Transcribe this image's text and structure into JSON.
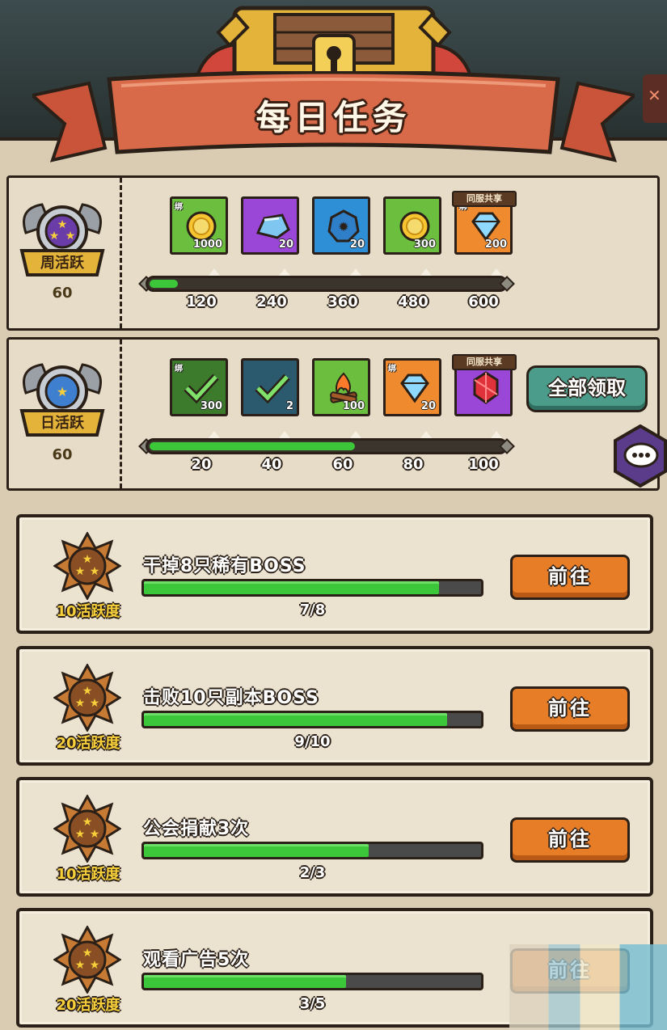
{
  "header": {
    "title": "每日任务"
  },
  "weekly": {
    "label": "周活跃",
    "value": "60",
    "progress": 0.08,
    "rewards": [
      {
        "icon": "gold-coin-icon",
        "qty": "1000",
        "bound": "绑",
        "bg": "#6cbf3e"
      },
      {
        "icon": "blue-stone-icon",
        "qty": "20",
        "bound": "",
        "bg": "#9a47d8"
      },
      {
        "icon": "gear-token-icon",
        "qty": "20",
        "bound": "",
        "bg": "#2f8fd6"
      },
      {
        "icon": "gold-coin-icon",
        "qty": "300",
        "bound": "",
        "bg": "#6cbf3e"
      },
      {
        "icon": "diamond-icon",
        "qty": "200",
        "bound": "绑",
        "bg": "#f08a2e",
        "tag": "同服共享"
      }
    ],
    "ticks": [
      "120",
      "240",
      "360",
      "480",
      "600"
    ]
  },
  "daily": {
    "label": "日活跃",
    "value": "60",
    "progress": 0.58,
    "rewards": [
      {
        "icon": "check-icon",
        "qty": "300",
        "bound": "绑",
        "bg": "#3c7a2c"
      },
      {
        "icon": "check-icon",
        "qty": "2",
        "bound": "",
        "bg": "#2b5a6e"
      },
      {
        "icon": "campfire-icon",
        "qty": "100",
        "bound": "",
        "bg": "#6cbf3e"
      },
      {
        "icon": "diamond-icon",
        "qty": "20",
        "bound": "绑",
        "bg": "#f08a2e"
      },
      {
        "icon": "red-gem-icon",
        "qty": "",
        "bound": "",
        "bg": "#9a47d8",
        "tag": "同服共享"
      }
    ],
    "ticks": [
      "20",
      "40",
      "60",
      "80",
      "100"
    ],
    "claim_all_label": "全部领取"
  },
  "tasks": [
    {
      "name": "干掉8只稀有BOSS",
      "reward": "10活跃度",
      "progress_text": "7/8",
      "progress": 0.875,
      "button": "前往"
    },
    {
      "name": "击败10只副本BOSS",
      "reward": "20活跃度",
      "progress_text": "9/10",
      "progress": 0.9,
      "button": "前往"
    },
    {
      "name": "公会捐献3次",
      "reward": "10活跃度",
      "progress_text": "2/3",
      "progress": 0.667,
      "button": "前往"
    },
    {
      "name": "观看广告5次",
      "reward": "20活跃度",
      "progress_text": "3/5",
      "progress": 0.6,
      "button": "前往"
    }
  ],
  "colors": {
    "progress_green": "#3cc63a",
    "button_orange": "#e87d28",
    "claim_teal": "#4b9c8a",
    "banner_red": "#c9543a",
    "gold_text": "#f7cf3a"
  }
}
